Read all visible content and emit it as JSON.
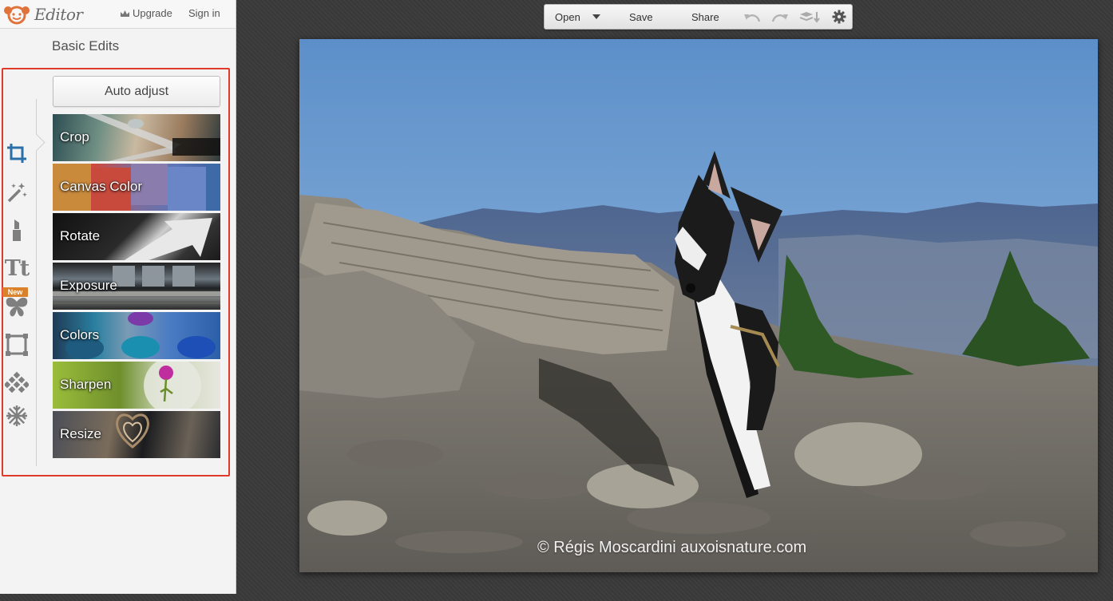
{
  "app": {
    "logo_text": "Editor",
    "upgrade_label": "Upgrade",
    "signin_label": "Sign in"
  },
  "panel": {
    "title": "Basic Edits",
    "auto_adjust_label": "Auto adjust",
    "tools": [
      {
        "icon": "crop-icon",
        "active": true
      },
      {
        "icon": "magic-wand-icon",
        "active": false
      },
      {
        "icon": "lipstick-icon",
        "active": false
      },
      {
        "icon": "text-icon",
        "active": false
      },
      {
        "icon": "butterfly-icon",
        "active": false
      },
      {
        "icon": "frame-icon",
        "active": false
      },
      {
        "icon": "texture-icon",
        "active": false
      },
      {
        "icon": "snowflake-icon",
        "active": false
      }
    ],
    "new_badge": "New",
    "edits": [
      {
        "label": "Crop"
      },
      {
        "label": "Canvas Color"
      },
      {
        "label": "Rotate"
      },
      {
        "label": "Exposure"
      },
      {
        "label": "Colors"
      },
      {
        "label": "Sharpen"
      },
      {
        "label": "Resize"
      }
    ],
    "highlight_color": "#e03a2a"
  },
  "toolbar": {
    "open_label": "Open",
    "save_label": "Save",
    "share_label": "Share"
  },
  "photo": {
    "watermark": "© Régis Moscardini auxoisnature.com"
  }
}
